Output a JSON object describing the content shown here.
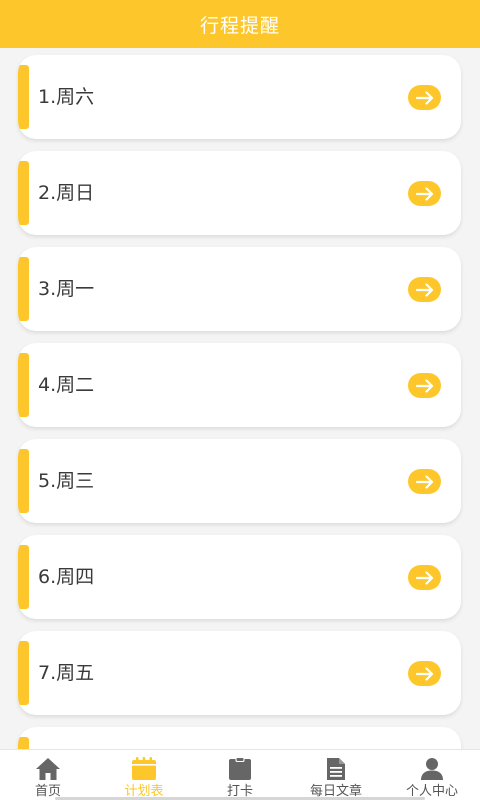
{
  "header": {
    "title": "行程提醒"
  },
  "schedule": {
    "items": [
      {
        "label": "1.周六"
      },
      {
        "label": "2.周日"
      },
      {
        "label": "3.周一"
      },
      {
        "label": "4.周二"
      },
      {
        "label": "5.周三"
      },
      {
        "label": "6.周四"
      },
      {
        "label": "7.周五"
      },
      {
        "label": ""
      }
    ]
  },
  "tabbar": {
    "tabs": [
      {
        "label": "首页",
        "icon": "home-icon",
        "active": false
      },
      {
        "label": "计划表",
        "icon": "calendar-icon",
        "active": true
      },
      {
        "label": "打卡",
        "icon": "clipboard-icon",
        "active": false
      },
      {
        "label": "每日文章",
        "icon": "document-icon",
        "active": false
      },
      {
        "label": "个人中心",
        "icon": "person-icon",
        "active": false
      }
    ]
  },
  "colors": {
    "accent": "#fdc72b",
    "background": "#f4f4f4",
    "text": "#3a3a3a",
    "tab_inactive": "#555555"
  }
}
